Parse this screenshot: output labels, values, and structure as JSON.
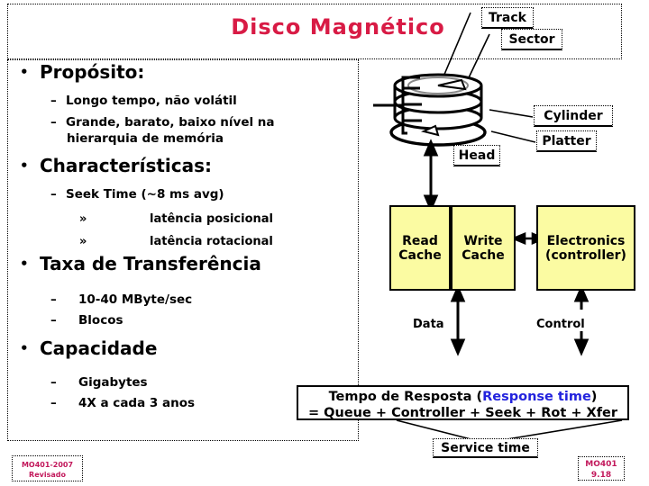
{
  "slide": {
    "title": "Disco Magnético",
    "title_color": "#d81b45",
    "accent_blue": "#2222dd",
    "box_yellow": "#fbfba2"
  },
  "body": {
    "b1_proposito": "Propósito:",
    "b2_longo": "Longo tempo, não volátil",
    "b2_grande": "Grande, barato, baixo nível na",
    "b2_grande_cont": "hierarquia de memória",
    "b1_caracteristicas": "Characterísticas:",
    "b2_seek": "Seek Time (~8 ms avg)",
    "b3_posicional": "latência posicional",
    "b3_rotacional": "latência rotacional",
    "b3_marker": "»",
    "b1_taxa": "Taxa de Transferência",
    "b2_mbyte": "10-40 MByte/sec",
    "b2_blocos": "Blocos",
    "b1_capacidade": "Capacidade",
    "b2_gigabytes": "Gigabytes",
    "b2_4x": "4X a cada 3 anos",
    "bullet": "•",
    "dash": "–"
  },
  "diagram": {
    "track": "Track",
    "sector": "Sector",
    "cylinder": "Cylinder",
    "platter": "Platter",
    "head": "Head",
    "read_cache_l1": "Read",
    "read_cache_l2": "Cache",
    "write_cache_l1": "Write",
    "write_cache_l2": "Cache",
    "electronics_l1": "Electronics",
    "electronics_l2": "(controller)",
    "data": "Data",
    "control": "Control"
  },
  "formula": {
    "line1_black": "Tempo de Resposta (",
    "line1_blue": "Response time",
    "line1_close": ")",
    "line2": "= Queue + Controller + Seek + Rot + Xfer",
    "service_time": "Service time"
  },
  "footer": {
    "left_line1": "MO401-2007",
    "left_line2": "Revisado",
    "right_line1": "MO401",
    "right_line2": "9.18"
  }
}
